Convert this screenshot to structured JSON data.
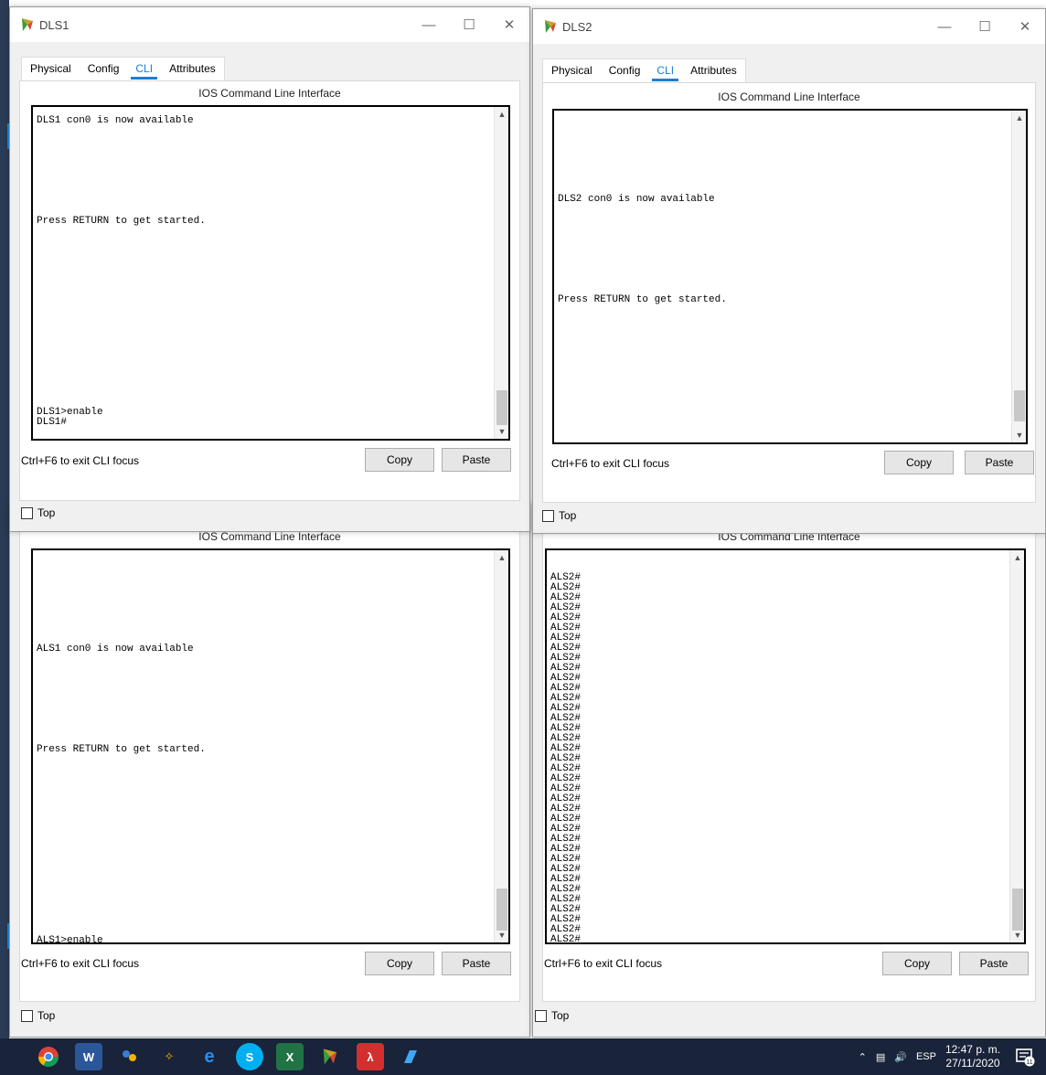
{
  "windows": {
    "dls1": {
      "title": "DLS1",
      "tabs": [
        "Physical",
        "Config",
        "CLI",
        "Attributes"
      ],
      "ios_header": "IOS Command Line Interface",
      "terminal_text": "DLS1 con0 is now available\n\n\n\n\n\n\n\n\n\nPress RETURN to get started.\n\n\n\n\n\n\n\n\n\n\n\n\n\n\n\n\n\n\nDLS1>enable\nDLS1#",
      "focus_hint": "Ctrl+F6 to exit CLI focus",
      "copy_label": "Copy",
      "paste_label": "Paste",
      "top_label": "Top"
    },
    "dls2": {
      "title": "DLS2",
      "tabs": [
        "Physical",
        "Config",
        "CLI",
        "Attributes"
      ],
      "ios_header": "IOS Command Line Interface",
      "terminal_text": "\n\n\n\n\n\n\n\nDLS2 con0 is now available\n\n\n\n\n\n\n\n\n\nPress RETURN to get started.",
      "focus_hint": "Ctrl+F6 to exit CLI focus",
      "copy_label": "Copy",
      "paste_label": "Paste",
      "top_label": "Top"
    },
    "als1": {
      "ios_header": "IOS Command Line Interface",
      "terminal_text": "\n\n\n\n\n\n\n\n\nALS1 con0 is now available\n\n\n\n\n\n\n\n\n\nPress RETURN to get started.\n\n\n\n\n\n\n\n\n\n\n\n\n\n\n\n\n\n\nALS1>enable",
      "focus_hint": "Ctrl+F6 to exit CLI focus",
      "copy_label": "Copy",
      "paste_label": "Paste",
      "top_label": "Top"
    },
    "als2": {
      "ios_header": "IOS Command Line Interface",
      "terminal_text": "\nALS2#\nALS2#\nALS2#\nALS2#\nALS2#\nALS2#\nALS2#\nALS2#\nALS2#\nALS2#\nALS2#\nALS2#\nALS2#\nALS2#\nALS2#\nALS2#\nALS2#\nALS2#\nALS2#\nALS2#\nALS2#\nALS2#\nALS2#\nALS2#\nALS2#\nALS2#\nALS2#\nALS2#\nALS2#\nALS2#\nALS2#\nALS2#\nALS2#\nALS2#\nALS2#\nALS2#\nALS2#",
      "focus_hint": "Ctrl+F6 to exit CLI focus",
      "copy_label": "Copy",
      "paste_label": "Paste",
      "top_label": "Top"
    }
  },
  "taskbar": {
    "apps": [
      "chrome-icon",
      "word-icon",
      "people-icon",
      "packet-icon",
      "edge-icon",
      "skype-icon",
      "excel-icon",
      "cisco-icon",
      "acrobat-icon",
      "app-icon"
    ],
    "language": "ESP",
    "time": "12:47 p. m.",
    "date": "27/11/2020",
    "notifications": "11"
  },
  "colors": {
    "accent": "#1b7fd6",
    "taskbar": "#19233a"
  }
}
